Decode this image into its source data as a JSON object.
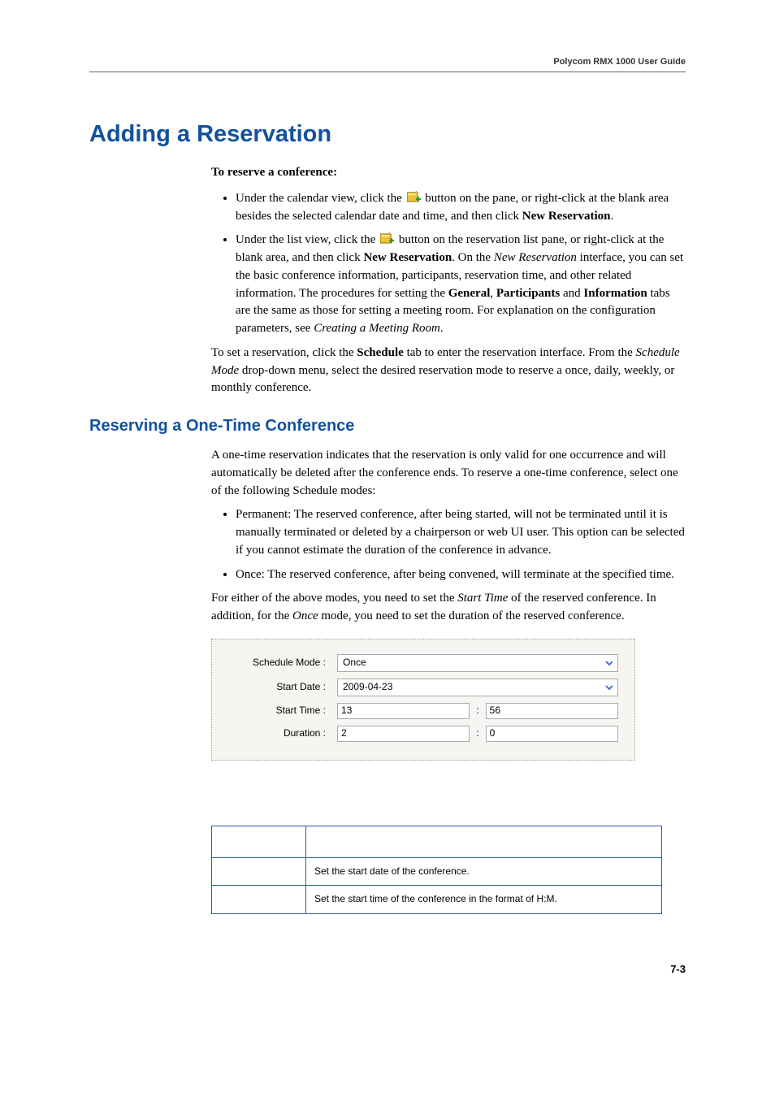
{
  "header": {
    "guide_title": "Polycom RMX 1000 User Guide"
  },
  "title": "Adding a Reservation",
  "intro": "To reserve a conference:",
  "bullet1": {
    "pre": "Under the calendar view, click the ",
    "post": " button on the pane, or right-click at the blank area besides the selected calendar date and time, and then click ",
    "bold_end": "New Reservation",
    "period": "."
  },
  "bullet2": {
    "pre": "Under the list view, click the ",
    "mid1": " button on the reservation list pane, or right-click at the blank area, and then click ",
    "bold1": "New Reservation",
    "mid2": ". On the ",
    "ital1": "New Reservation",
    "mid3": " interface, you can set the basic conference information, participants, reservation time, and other related information. The procedures for setting the ",
    "bold2": "General",
    "sep1": ", ",
    "bold3": "Participants",
    "mid4": " and ",
    "bold4": "Information",
    "mid5": " tabs are the same as those for setting a meeting room. For explanation on the configuration parameters, see ",
    "ital2": "Creating a Meeting Room",
    "period": "."
  },
  "para_set": {
    "p1a": "To set a reservation, click the ",
    "p1b": "Schedule",
    "p1c": " tab to enter the reservation interface. From the ",
    "p1d": "Schedule Mode",
    "p1e": " drop-down menu, select the desired reservation mode to reserve a once, daily, weekly, or monthly conference."
  },
  "subheading": "Reserving a One-Time Conference",
  "onetime_intro": "A one-time reservation indicates that the reservation is only valid for one occurrence and will automatically be deleted after the conference ends. To reserve a one-time conference, select one of the following Schedule modes:",
  "ot_b1": "Permanent: The reserved conference, after being started, will not be terminated until it is manually terminated or deleted by a chairperson or web UI user. This option can be selected if you cannot estimate the duration of the conference in advance.",
  "ot_b2": "Once: The reserved conference, after being convened, will terminate at the specified time.",
  "para_modes": {
    "a": "For either of the above modes, you need to set the ",
    "b": "Start Time",
    "c": " of the reserved conference. In addition, for the ",
    "d": "Once",
    "e": " mode, you need to set the duration of the reserved conference."
  },
  "form": {
    "labels": {
      "mode": "Schedule Mode :",
      "date": "Start Date :",
      "time": "Start Time :",
      "duration": "Duration :"
    },
    "mode_value": "Once",
    "date_value": "2009-04-23",
    "time_h": "13",
    "time_m": "56",
    "dur_h": "2",
    "dur_m": "0"
  },
  "table": {
    "row1": "Set the start date of the conference.",
    "row2": "Set the start time of the conference in the format of H:M."
  },
  "page_number": "7-3"
}
